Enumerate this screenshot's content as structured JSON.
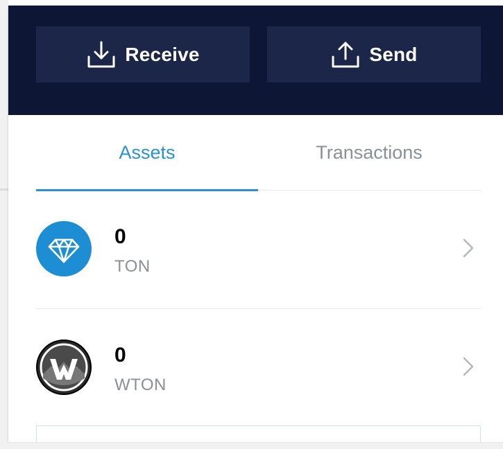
{
  "actions": {
    "receive_label": "Receive",
    "send_label": "Send"
  },
  "tabs": [
    {
      "label": "Assets",
      "active": true
    },
    {
      "label": "Transactions",
      "active": false
    }
  ],
  "assets": [
    {
      "amount": "0",
      "symbol": "TON",
      "icon": "ton-diamond-icon",
      "icon_color": "#1d8ed3"
    },
    {
      "amount": "0",
      "symbol": "WTON",
      "icon": "wton-logo-icon",
      "icon_color": "#2a2a2a"
    }
  ],
  "colors": {
    "header_bg": "#0d1634",
    "button_bg": "#1b2648",
    "accent": "#2b8fd1",
    "muted_text": "#8a9098"
  },
  "icons": {
    "receive": "download-icon",
    "send": "upload-icon",
    "row_arrow": "chevron-right-icon"
  }
}
